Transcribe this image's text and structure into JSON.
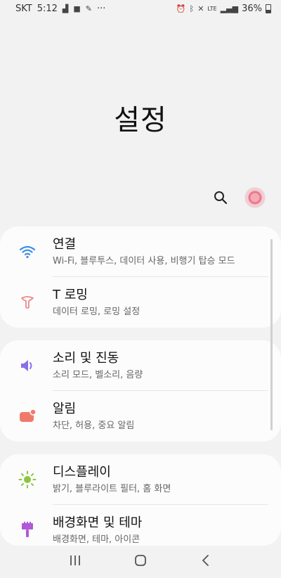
{
  "status_bar": {
    "carrier": "SKT",
    "time": "5:12",
    "more": "···",
    "network": "LTE",
    "battery": "36%"
  },
  "page": {
    "title": "설정"
  },
  "cards": [
    {
      "items": [
        {
          "title": "연결",
          "subtitle": "Wi-Fi, 블루투스, 데이터 사용, 비행기 탑승 모드",
          "icon": "wifi-icon",
          "color": "#3d8ee8"
        },
        {
          "title": "T 로밍",
          "subtitle": "데이터 로밍, 로밍 설정",
          "icon": "t-roaming-icon",
          "color": "#ee8a8a"
        }
      ]
    },
    {
      "items": [
        {
          "title": "소리 및 진동",
          "subtitle": "소리 모드, 벨소리, 음량",
          "icon": "speaker-icon",
          "color": "#8a6ee8"
        },
        {
          "title": "알림",
          "subtitle": "차단, 허용, 중요 알림",
          "icon": "notification-icon",
          "color": "#f07a6a"
        }
      ]
    },
    {
      "items": [
        {
          "title": "디스플레이",
          "subtitle": "밝기, 블루라이트 필터, 홈 화면",
          "icon": "brightness-icon",
          "color": "#8cc63f"
        },
        {
          "title": "배경화면 및 테마",
          "subtitle": "배경화면, 테마, 아이콘",
          "icon": "theme-brush-icon",
          "color": "#b05ad6"
        }
      ]
    }
  ]
}
